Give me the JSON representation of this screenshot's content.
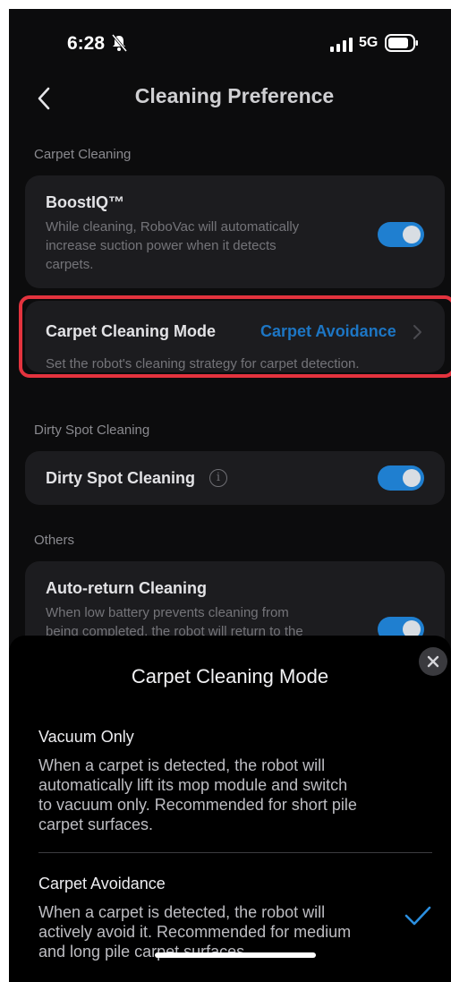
{
  "status_bar": {
    "time": "6:28",
    "network": "5G"
  },
  "header": {
    "title": "Cleaning Preference"
  },
  "sections": {
    "carpet": {
      "label": "Carpet Cleaning",
      "boostiq": {
        "title": "BoostIQ™",
        "desc_lines": [
          "While cleaning, RoboVac will automatically",
          "increase suction power when it detects",
          "carpets."
        ],
        "enabled": true
      },
      "mode": {
        "title": "Carpet Cleaning Mode",
        "value": "Carpet Avoidance",
        "desc": "Set the robot's cleaning strategy for carpet detection."
      }
    },
    "dirty_spot": {
      "label": "Dirty Spot Cleaning",
      "item": {
        "title": "Dirty Spot Cleaning",
        "enabled": true
      }
    },
    "others": {
      "label": "Others",
      "auto_return": {
        "title": "Auto-return Cleaning",
        "desc_lines": [
          "When low battery prevents cleaning from",
          "being completed, the robot will return to the"
        ],
        "enabled": true
      }
    }
  },
  "sheet": {
    "title": "Carpet Cleaning Mode",
    "options": [
      {
        "title": "Vacuum Only",
        "desc_lines": [
          "When a carpet is detected, the robot will",
          "automatically lift its mop module and switch",
          "to vacuum only. Recommended for short pile",
          "carpet surfaces."
        ],
        "selected": false
      },
      {
        "title": "Carpet Avoidance",
        "desc_lines": [
          "When a carpet is detected, the robot will",
          "actively avoid it. Recommended for medium",
          "and long pile carpet surfaces."
        ],
        "selected": true
      }
    ]
  },
  "colors": {
    "accent": "#1f7fd0",
    "highlight": "#e3333e",
    "background": "#0c0c0d",
    "card": "#1c1c1f"
  }
}
